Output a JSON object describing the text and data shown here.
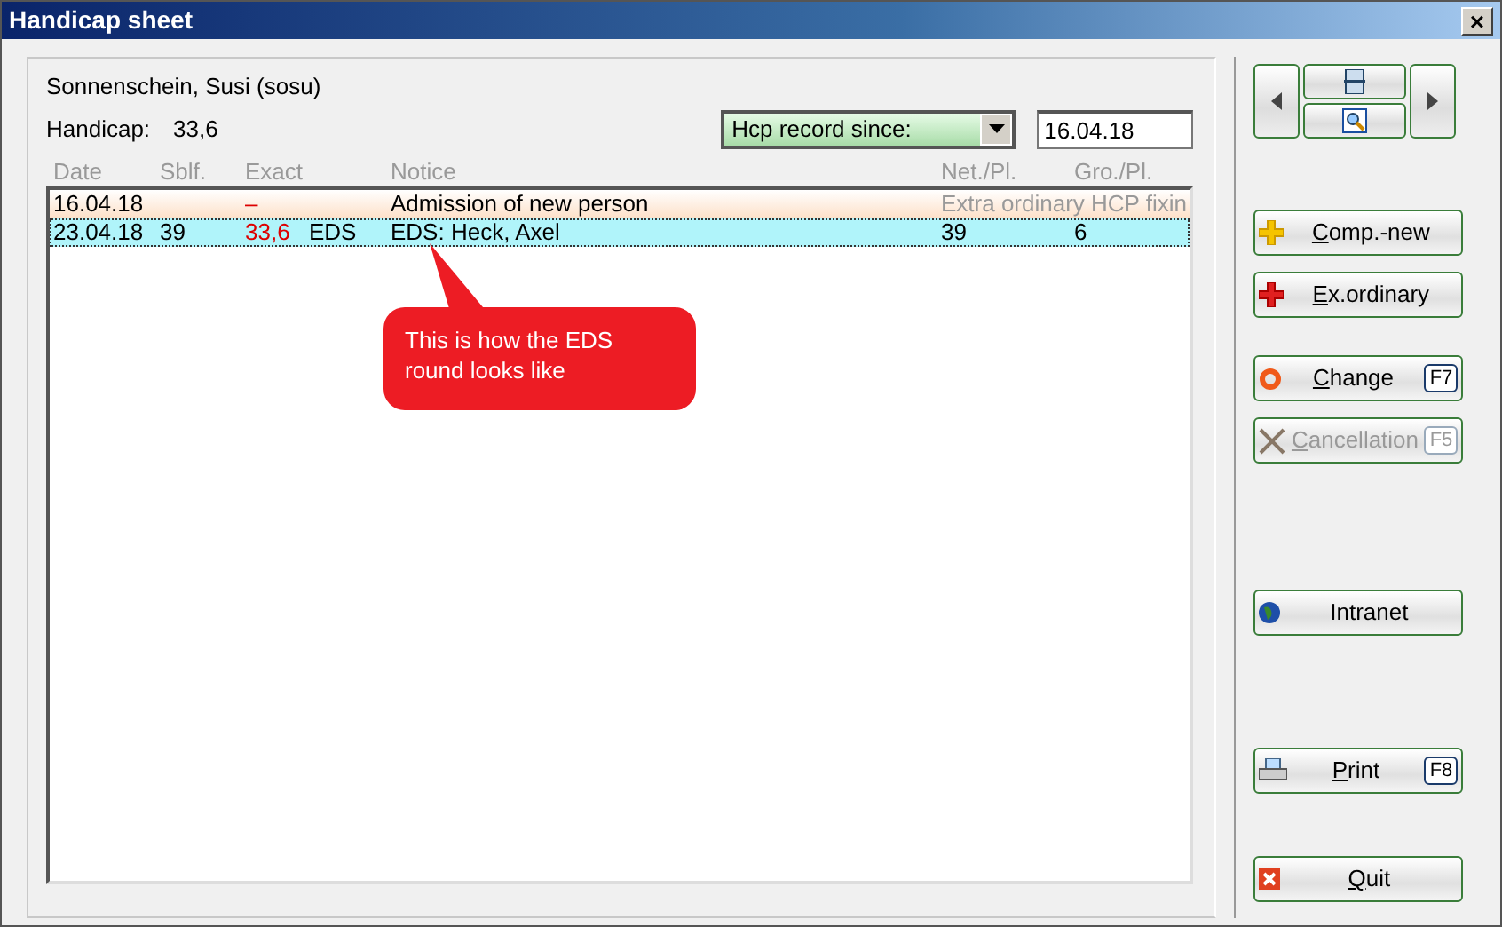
{
  "window": {
    "title": "Handicap sheet",
    "close": "×"
  },
  "player": {
    "name": "Sonnenschein, Susi (sosu)",
    "handicap_label": "Handicap:",
    "handicap": "33,6"
  },
  "filter": {
    "value": "Hcp record since:",
    "date": "16.04.18"
  },
  "table": {
    "columns": [
      "Date",
      "Sblf.",
      "Exact",
      "",
      "Notice",
      "Net./Pl.",
      "Gro./Pl."
    ],
    "rows": [
      {
        "kind": "admission",
        "selected": false,
        "cells": [
          "16.04.18",
          "",
          "–",
          "",
          "Admission of new person",
          "Extra ordinary HCP fixin",
          ""
        ]
      },
      {
        "kind": "round",
        "selected": true,
        "cells": [
          "23.04.18",
          "39",
          "33,6",
          "EDS",
          "EDS: Heck, Axel",
          "39",
          "6"
        ]
      }
    ]
  },
  "callout": "This is how the EDS round looks like",
  "nav": [
    {
      "kind": "prev"
    },
    {
      "kind": "print"
    },
    {
      "kind": "preview"
    },
    {
      "kind": "next"
    }
  ],
  "buttons": [
    {
      "label": "Comp.-new",
      "disabled": false
    },
    {
      "label": "Ex.ordinary",
      "disabled": false
    },
    {
      "label": "Change",
      "key": "F7",
      "disabled": false
    },
    {
      "label": "Cancellation",
      "key": "F5",
      "disabled": true
    },
    {
      "label": "Intranet",
      "disabled": false
    },
    {
      "label": "Print",
      "key": "F8",
      "disabled": false
    },
    {
      "label": "Quit",
      "disabled": false
    }
  ]
}
